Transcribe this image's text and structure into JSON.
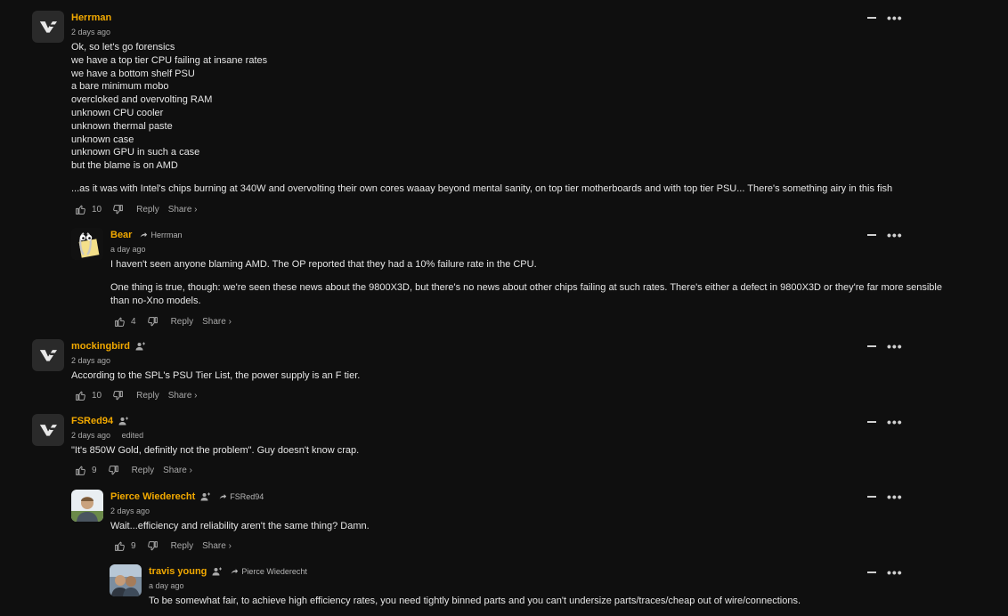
{
  "comments": [
    {
      "user": "Herrman",
      "time": "2 days ago",
      "lines": [
        "Ok, so let's go forensics",
        "we have a top tier CPU failing at insane rates",
        "we have a bottom shelf PSU",
        "a bare minimum mobo",
        "overcloked and overvolting RAM",
        "unknown CPU cooler",
        "unknown thermal paste",
        "unknown case",
        "unknown GPU in such a case",
        "but the blame is on AMD"
      ],
      "para2": "...as it was with Intel's chips burning at 340W and overvolting their own cores waaay beyond mental sanity, on top tier motherboards and with top tier PSU... There's something airy in this fish",
      "likes": "10",
      "reply_label": "Reply",
      "share_label": "Share ›"
    },
    {
      "user": "Bear",
      "reply_to": "Herrman",
      "time": "a day ago",
      "para1": "I haven't seen anyone blaming AMD. The OP reported that they had a 10% failure rate in the CPU.",
      "para2a": "One thing is true, though: we're seen these news about the 9800X3D, but there's no news about other chips failing at such rates. There's either a defect in 9800X3D or they're far more sensible",
      "para2b": "than no-Xno models.",
      "likes": "4",
      "reply_label": "Reply",
      "share_label": "Share ›"
    },
    {
      "user": "mockingbird",
      "time": "2 days ago",
      "text": "According to the SPL's PSU Tier List, the power supply is an F tier.",
      "likes": "10",
      "reply_label": "Reply",
      "share_label": "Share ›"
    },
    {
      "user": "FSRed94",
      "time": "2 days ago",
      "edited": "edited",
      "text": "\"It's 850W Gold, definitly not the problem\". Guy doesn't know crap.",
      "likes": "9",
      "reply_label": "Reply",
      "share_label": "Share ›"
    },
    {
      "user": "Pierce Wiederecht",
      "reply_to": "FSRed94",
      "time": "2 days ago",
      "text": "Wait...efficiency and reliability aren't the same thing? Damn.",
      "likes": "9",
      "reply_label": "Reply",
      "share_label": "Share ›"
    },
    {
      "user": "travis young",
      "reply_to": "Pierce Wiederecht",
      "time": "a day ago",
      "text": "To be somewhat fair, to achieve high efficiency rates, you need tightly binned parts and you can't undersize parts/traces/cheap out of wire/connections."
    }
  ],
  "icons": {
    "like": "thumbs-up-icon",
    "dislike": "thumbs-down-icon",
    "follow": "user-plus-icon",
    "reply_arrow": "reply-arrow-icon",
    "collapse": "minus-icon",
    "more": "ellipsis-icon"
  },
  "colors": {
    "username": "#f2a900",
    "background": "#0f0f0f"
  }
}
